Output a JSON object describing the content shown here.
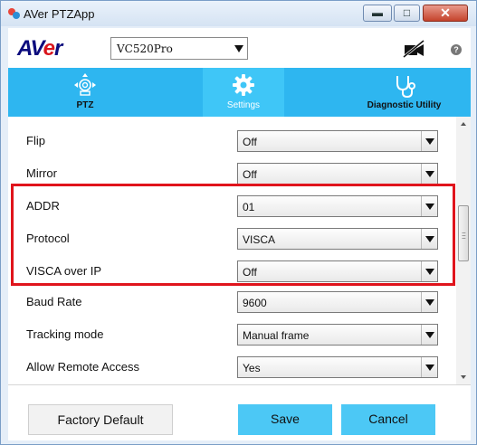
{
  "window": {
    "title": "AVer PTZApp"
  },
  "header": {
    "logo_prefix": "AV",
    "logo_red": "e",
    "logo_suffix": "r",
    "device": "VC520Pro",
    "help_glyph": "?"
  },
  "tabs": [
    {
      "label": "PTZ",
      "icon": "ptz-camera-icon",
      "active": false
    },
    {
      "label": "Settings",
      "icon": "gear-icon",
      "active": true
    },
    {
      "label": "Diagnostic Utility",
      "icon": "stethoscope-icon",
      "active": false
    }
  ],
  "settings": [
    {
      "label": "Flip",
      "value": "Off"
    },
    {
      "label": "Mirror",
      "value": "Off"
    },
    {
      "label": "ADDR",
      "value": "01"
    },
    {
      "label": "Protocol",
      "value": "VISCA"
    },
    {
      "label": "VISCA over IP",
      "value": "Off"
    },
    {
      "label": "Baud Rate",
      "value": "9600"
    },
    {
      "label": "Tracking mode",
      "value": "Manual frame"
    },
    {
      "label": "Allow Remote Access",
      "value": "Yes"
    }
  ],
  "footer": {
    "factory_label": "Factory Default",
    "save_label": "Save",
    "cancel_label": "Cancel"
  },
  "colors": {
    "accent": "#2eb6f0",
    "button": "#4cc8f5",
    "highlight": "#e0141c",
    "logo_blue": "#0b0b7d"
  }
}
